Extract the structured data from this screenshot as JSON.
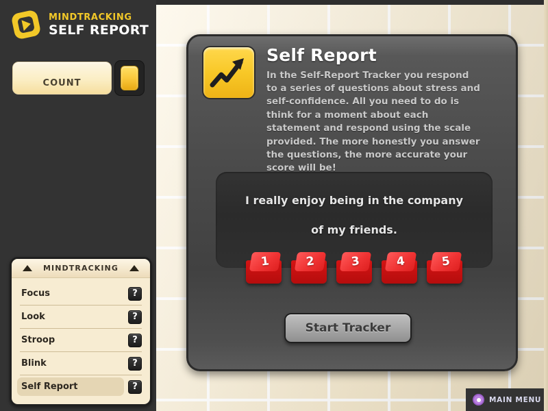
{
  "brand": {
    "logo_icon": "play-logo-icon",
    "line1": "MINDTRACKING",
    "line2": "SELF REPORT"
  },
  "counter": {
    "label": "COUNT",
    "chip_color": "#fbc93c"
  },
  "menu_card": {
    "title": "MINDTRACKING",
    "arrow_left_icon": "triangle-up-icon",
    "arrow_right_icon": "triangle-up-icon",
    "items": [
      {
        "label": "Focus",
        "help": "?",
        "selected": false
      },
      {
        "label": "Look",
        "help": "?",
        "selected": false
      },
      {
        "label": "Stroop",
        "help": "?",
        "selected": false
      },
      {
        "label": "Blink",
        "help": "?",
        "selected": false
      },
      {
        "label": "Self Report",
        "help": "?",
        "selected": true
      }
    ]
  },
  "panel": {
    "icon": "trending-up-arrow-icon",
    "title": "Self Report",
    "description": "In the Self-Report Tracker you respond to a series of questions about stress and self-confidence. All you need to do is think for a moment about each statement and respond using the scale provided. The more honestly you answer the questions, the more accurate your score will be!",
    "statement": {
      "line1": "I really enjoy being in the company",
      "line2": "of my friends."
    },
    "scale_keys": [
      "1",
      "2",
      "3",
      "4",
      "5"
    ],
    "start_button": "Start Tracker"
  },
  "main_menu": {
    "icon": "circle-dot-icon",
    "label": "MAIN MENU"
  },
  "colors": {
    "accent_yellow": "#f2c828",
    "panel_dark": "#4b4b4b",
    "sidebar_dark": "#333333",
    "tile_cream": "#f7ecd2",
    "key_red": "#d41414",
    "menu_purple": "#b97fe0"
  }
}
